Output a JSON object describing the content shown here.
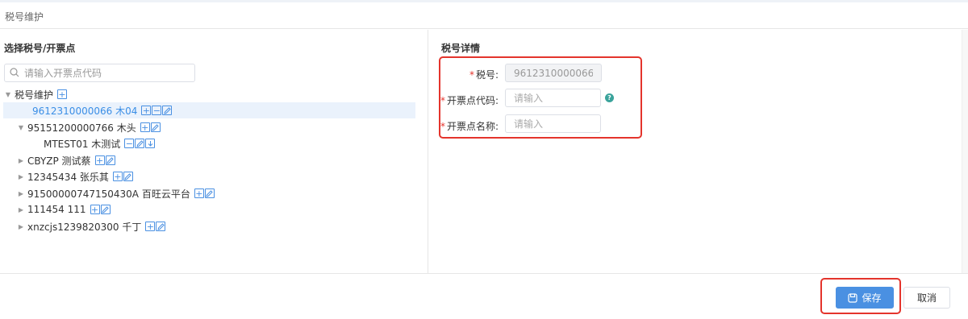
{
  "header": {
    "title": "税号维护"
  },
  "left": {
    "title": "选择税号/开票点",
    "search_placeholder": "请输入开票点代码",
    "tree": [
      {
        "label": "税号维护",
        "actions": [
          "add"
        ]
      },
      {
        "label": "9612310000066 木04",
        "actions": [
          "add",
          "remove",
          "edit"
        ],
        "selected": true
      },
      {
        "label": "95151200000766 木头",
        "actions": [
          "add",
          "edit"
        ]
      },
      {
        "label": "MTEST01 木测试",
        "actions": [
          "remove",
          "edit",
          "download"
        ]
      },
      {
        "label": "CBYZP 测试蔡",
        "actions": [
          "add",
          "edit"
        ]
      },
      {
        "label": "12345434 张乐其",
        "actions": [
          "add",
          "edit"
        ]
      },
      {
        "label": "91500000747150430A 百旺云平台",
        "actions": [
          "add",
          "edit"
        ]
      },
      {
        "label": "111454 111",
        "actions": [
          "add",
          "edit"
        ]
      },
      {
        "label": "xnzcjs1239820300 千丁",
        "actions": [
          "add",
          "edit"
        ]
      }
    ]
  },
  "right": {
    "title": "税号详情",
    "fields": [
      {
        "label": "税号:",
        "value": "9612310000066",
        "placeholder": "",
        "disabled": true
      },
      {
        "label": "开票点代码:",
        "value": "",
        "placeholder": "请输入",
        "disabled": false
      },
      {
        "label": "开票点名称:",
        "value": "",
        "placeholder": "请输入",
        "disabled": false
      }
    ],
    "help_icon": "question-icon"
  },
  "footer": {
    "save_label": "保存",
    "cancel_label": "取消"
  },
  "colors": {
    "primary": "#4a90e2",
    "highlight": "#e4342c",
    "selected_bg": "#eaf2fc"
  }
}
